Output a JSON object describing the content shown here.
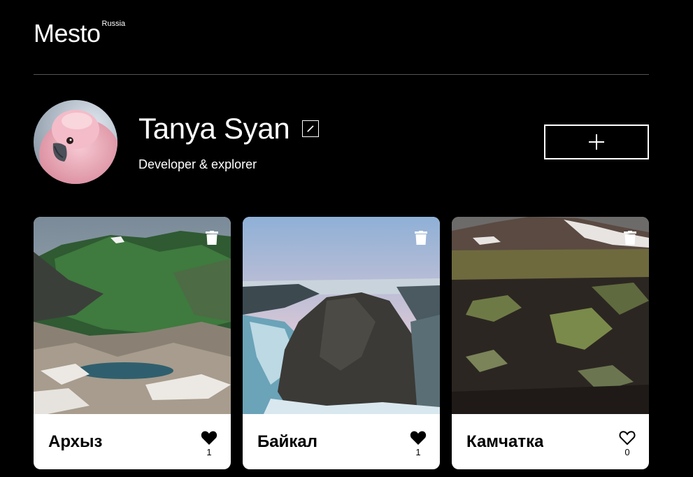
{
  "header": {
    "logo": "Mesto",
    "logo_sup": "Russia"
  },
  "profile": {
    "name": "Tanya Syan",
    "about": "Developer & explorer"
  },
  "cards": [
    {
      "title": "Архыз",
      "likes": "1",
      "liked": true
    },
    {
      "title": "Байкал",
      "likes": "1",
      "liked": true
    },
    {
      "title": "Камчатка",
      "likes": "0",
      "liked": false
    }
  ],
  "colors": {
    "background": "#000000",
    "text": "#ffffff",
    "card_bg": "#ffffff",
    "divider": "#545454"
  },
  "icons": {
    "edit": "pencil-icon",
    "add": "plus-icon",
    "delete": "trash-icon",
    "like": "heart-icon"
  }
}
